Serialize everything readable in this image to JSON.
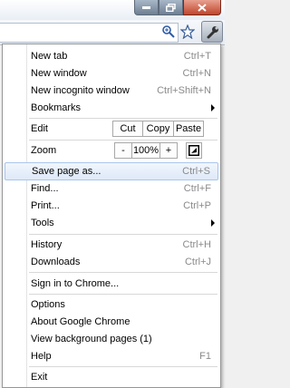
{
  "menu": {
    "new_tab": {
      "label": "New tab",
      "accel": "Ctrl+T"
    },
    "new_window": {
      "label": "New window",
      "accel": "Ctrl+N"
    },
    "new_incognito": {
      "label": "New incognito window",
      "accel": "Ctrl+Shift+N"
    },
    "bookmarks": {
      "label": "Bookmarks"
    },
    "edit": {
      "label": "Edit",
      "cut": "Cut",
      "copy": "Copy",
      "paste": "Paste"
    },
    "zoom": {
      "label": "Zoom",
      "minus": "-",
      "value": "100%",
      "plus": "+"
    },
    "save_page": {
      "label": "Save page as...",
      "accel": "Ctrl+S"
    },
    "find": {
      "label": "Find...",
      "accel": "Ctrl+F"
    },
    "print": {
      "label": "Print...",
      "accel": "Ctrl+P"
    },
    "tools": {
      "label": "Tools"
    },
    "history": {
      "label": "History",
      "accel": "Ctrl+H"
    },
    "downloads": {
      "label": "Downloads",
      "accel": "Ctrl+J"
    },
    "sign_in": {
      "label": "Sign in to Chrome..."
    },
    "options": {
      "label": "Options"
    },
    "about": {
      "label": "About Google Chrome"
    },
    "background_pages": {
      "label": "View background pages (1)"
    },
    "help": {
      "label": "Help",
      "accel": "F1"
    },
    "exit": {
      "label": "Exit"
    }
  },
  "icons": {
    "minimize": "minimize-icon",
    "maximize": "maximize-icon",
    "close": "close-icon",
    "zoom_search": "search-icon",
    "bookmark_star": "star-icon",
    "wrench": "wrench-icon",
    "fullscreen": "fullscreen-icon"
  },
  "colors": {
    "highlight_border": "#a9c5ec",
    "highlight_fill": "#dde9f8",
    "accel_text": "#8a8a8a",
    "close_button": "#c0452c"
  }
}
